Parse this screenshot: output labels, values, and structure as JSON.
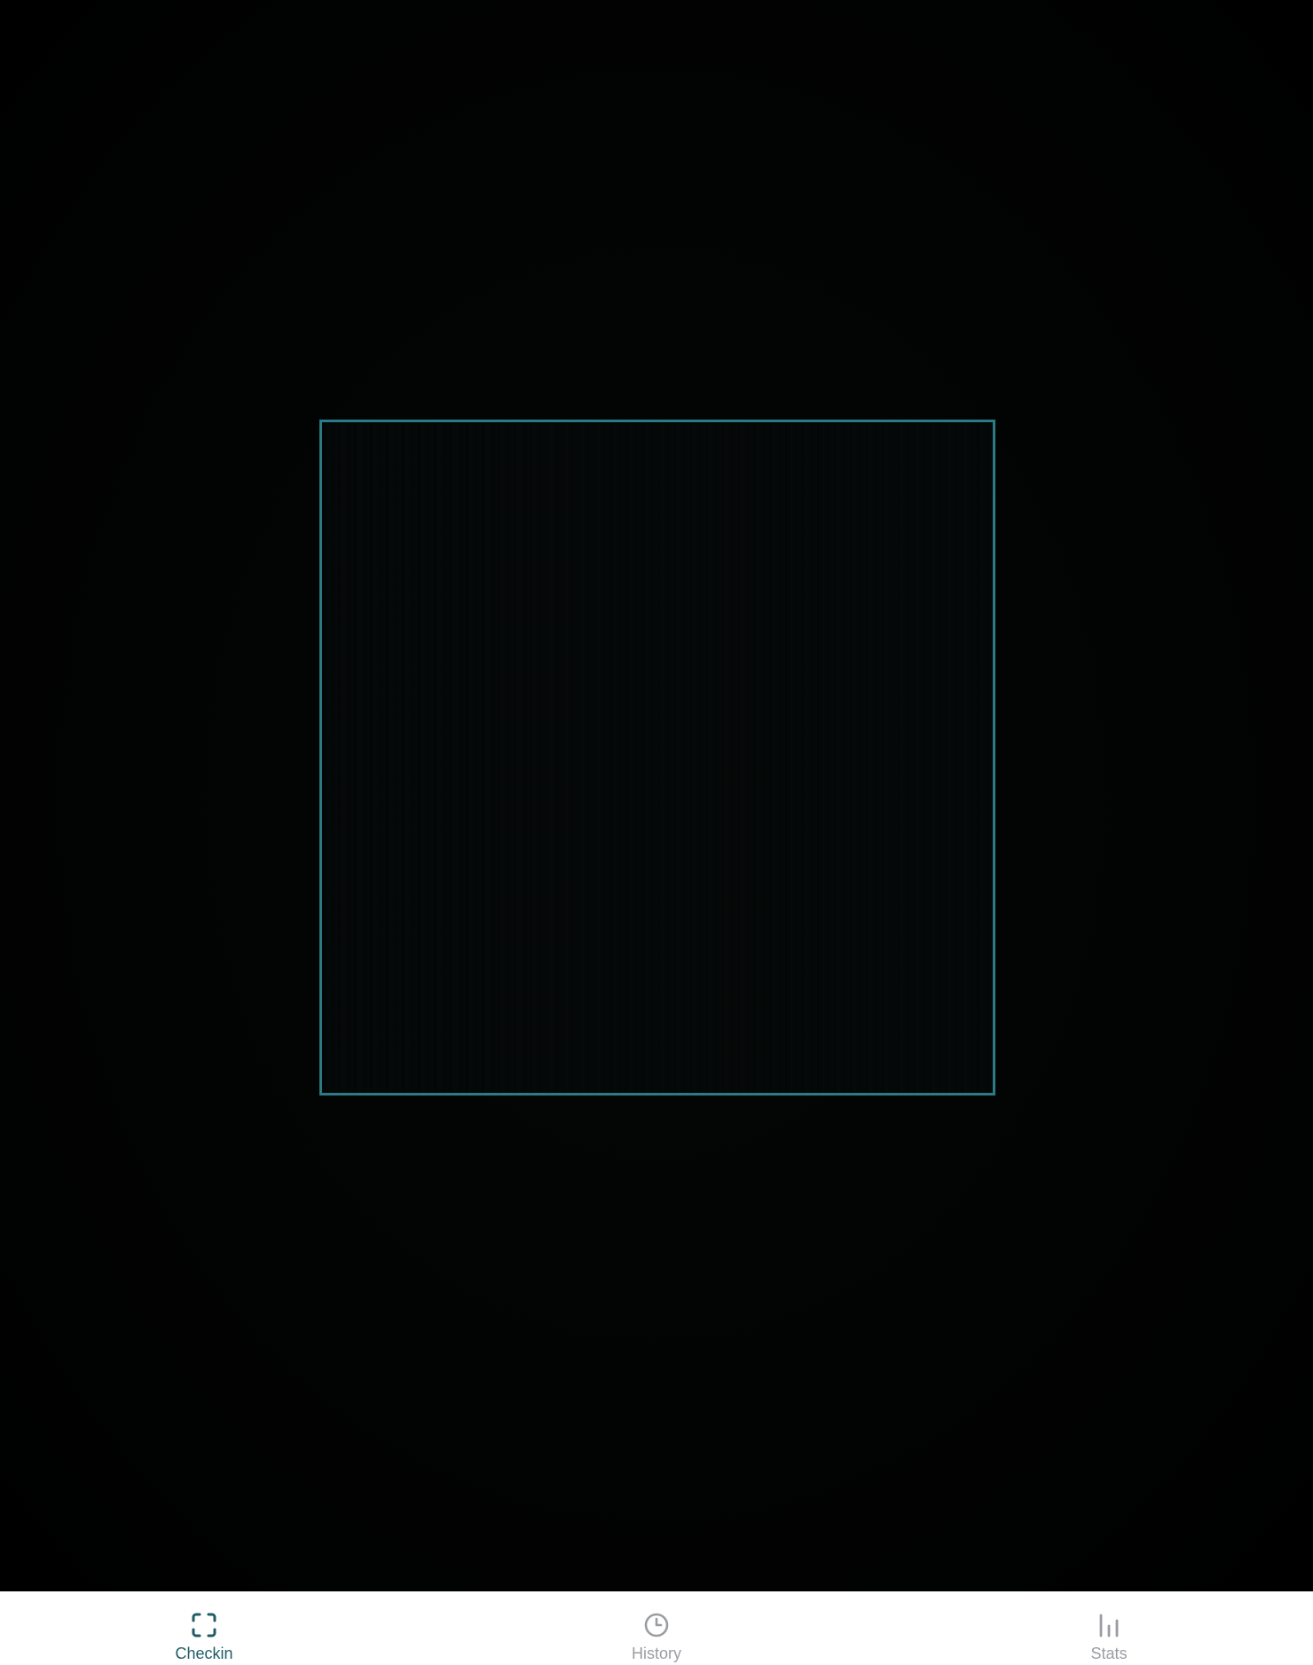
{
  "theme": {
    "accent": "#1f5c66",
    "frame_color": "#2a7b85",
    "inactive": "#9a9ea3",
    "background": "#000000",
    "tab_bar_bg": "#ffffff"
  },
  "tabs": [
    {
      "label": "Checkin",
      "icon": "scan-icon",
      "active": true
    },
    {
      "label": "History",
      "icon": "clock-icon",
      "active": false
    },
    {
      "label": "Stats",
      "icon": "bar-chart-icon",
      "active": false
    }
  ]
}
